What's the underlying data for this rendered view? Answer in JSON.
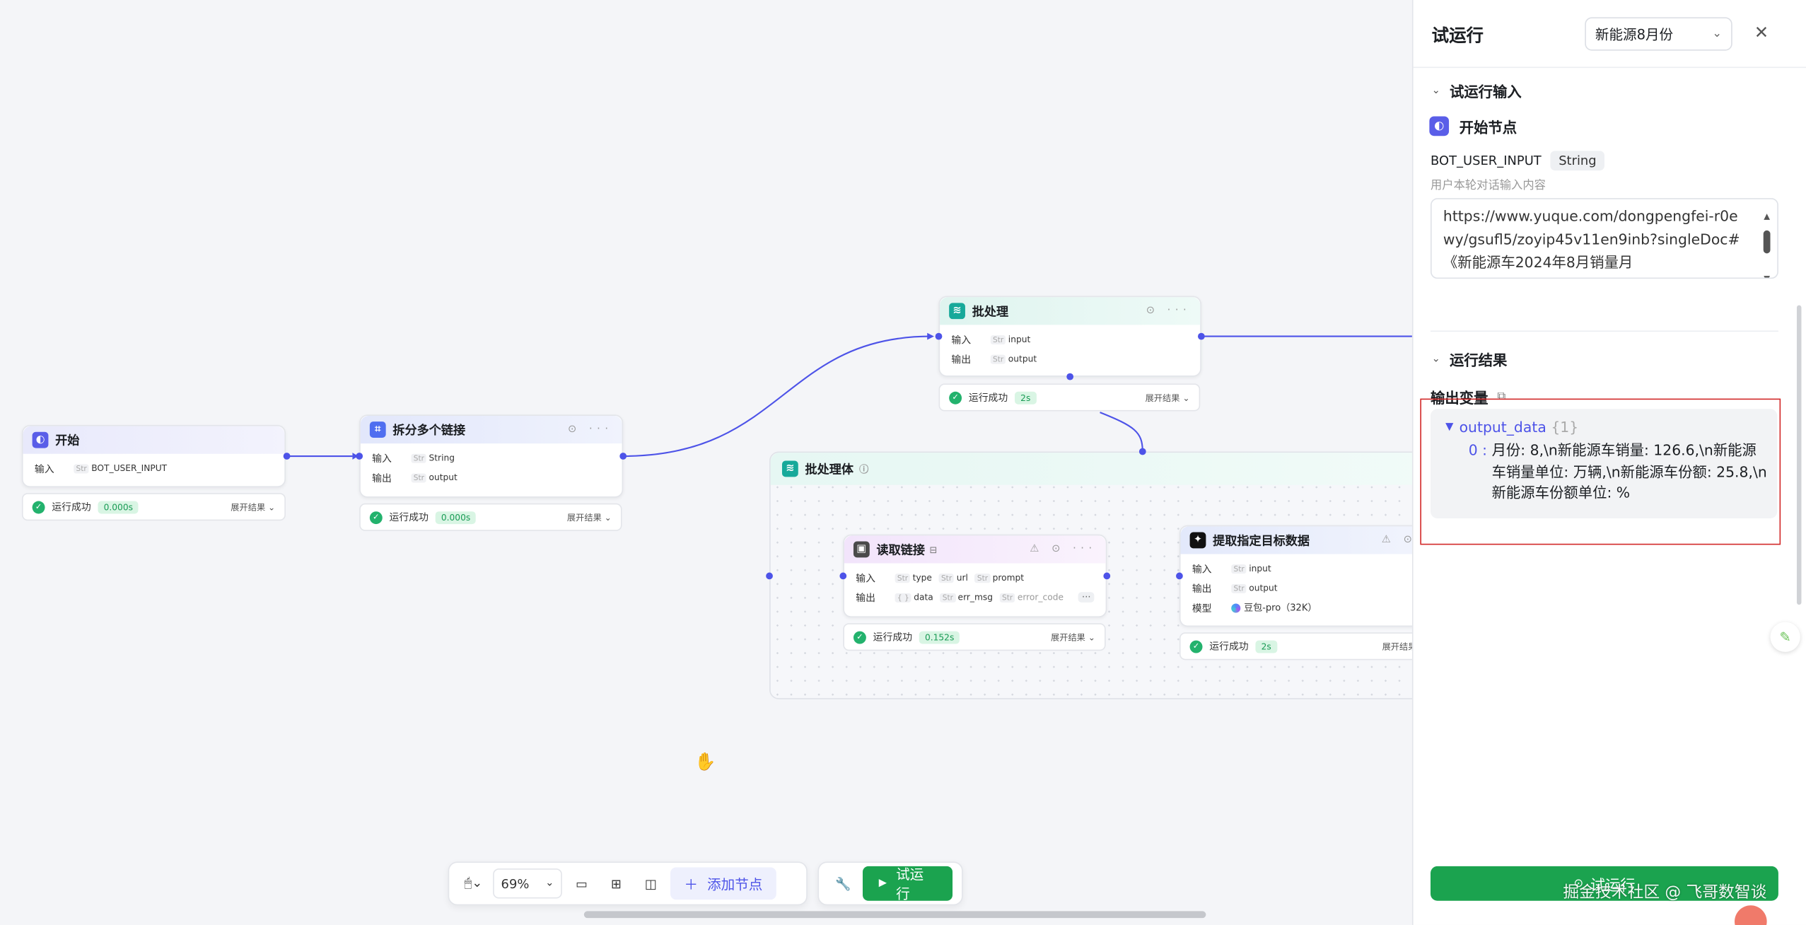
{
  "nodes": {
    "start": {
      "title": "开始",
      "input_label": "输入",
      "input_tag": "Str",
      "input_value": "BOT_USER_INPUT",
      "status": "运行成功",
      "time": "0.000s",
      "expand": "展开结果"
    },
    "split": {
      "title": "拆分多个链接",
      "input_label": "输入",
      "input_tag": "Str",
      "input_value": "String",
      "output_label": "输出",
      "output_tag": "Str",
      "output_value": "output",
      "status": "运行成功",
      "time": "0.000s",
      "expand": "展开结果"
    },
    "batch": {
      "title": "批处理",
      "input_label": "输入",
      "input_tag": "Str",
      "input_value": "input",
      "output_label": "输出",
      "output_tag": "Str",
      "output_value": "output",
      "status": "运行成功",
      "time": "2s",
      "expand": "展开结果"
    },
    "batch_body": {
      "title": "批处理体"
    },
    "read_link": {
      "title": "读取链接",
      "input_label": "输入",
      "inputs": [
        {
          "tag": "Str",
          "name": "type"
        },
        {
          "tag": "Str",
          "name": "url"
        },
        {
          "tag": "Str",
          "name": "prompt"
        }
      ],
      "output_label": "输出",
      "outputs": [
        {
          "tag": "{ }",
          "name": "data"
        },
        {
          "tag": "Str",
          "name": "err_msg"
        },
        {
          "tag": "Str",
          "name": "error_code"
        }
      ],
      "status": "运行成功",
      "time": "0.152s",
      "expand": "展开结果"
    },
    "extract": {
      "title": "提取指定目标数据",
      "input_label": "输入",
      "input_tag": "Str",
      "input_value": "input",
      "output_label": "输出",
      "output_tag": "Str",
      "output_value": "output",
      "model_label": "模型",
      "model_value": "豆包-pro（32K）",
      "status": "运行成功",
      "time": "2s",
      "expand": "展开结果"
    }
  },
  "toolbar": {
    "zoom": "69%",
    "add_node": "添加节点",
    "test_run": "试运行"
  },
  "panel": {
    "title": "试运行",
    "select_value": "新能源8月份",
    "section_input": "试运行输入",
    "start_node": "开始节点",
    "var_name": "BOT_USER_INPUT",
    "var_type": "String",
    "hint": "用户本轮对话输入内容",
    "input_text": "https://www.yuque.com/dongpengfei-r0ewy/gsufl5/zoyip45v11en9inb?singleDoc# 《新能源车2024年8月销量月",
    "section_result": "运行结果",
    "output_vars": "输出变量",
    "output_key": "output_data",
    "output_count": "{1}",
    "output_index": "0 :",
    "output_value": "月份: 8,\\n新能源车销量: 126.6,\\n新能源车销量单位: 万辆,\\n新能源车份额: 25.8,\\n新能源车份额单位: %",
    "run_button": "试运行",
    "watermark": "掘金技术社区 @ 飞哥数智谈"
  }
}
